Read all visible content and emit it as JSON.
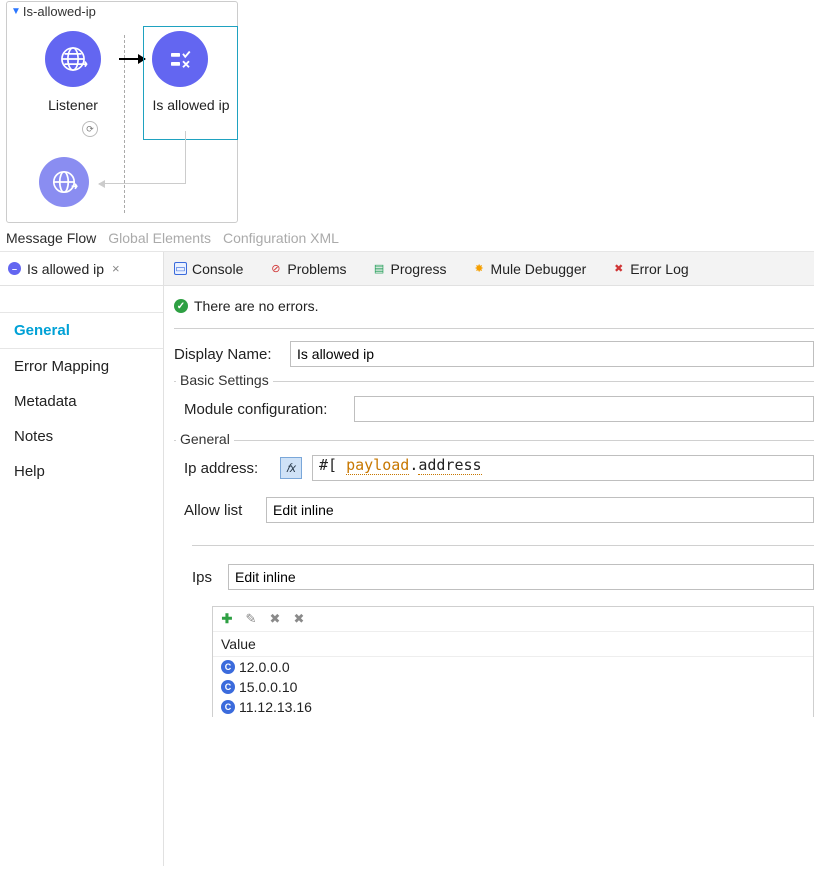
{
  "flow": {
    "title": "Is-allowed-ip",
    "listener_label": "Listener",
    "component_label": "Is allowed ip"
  },
  "editor_tabs": {
    "message_flow": "Message Flow",
    "global_elements": "Global Elements",
    "config_xml": "Configuration XML"
  },
  "detail_tab": {
    "label": "Is allowed ip"
  },
  "side_nav": {
    "general": "General",
    "error_mapping": "Error Mapping",
    "metadata": "Metadata",
    "notes": "Notes",
    "help": "Help"
  },
  "tabstrip": {
    "console": "Console",
    "problems": "Problems",
    "progress": "Progress",
    "mule_debugger": "Mule Debugger",
    "error_log": "Error Log"
  },
  "status": {
    "message": "There are no errors."
  },
  "form": {
    "display_name_label": "Display Name:",
    "display_name_value": "Is allowed ip",
    "basic_legend": "Basic Settings",
    "module_config_label": "Module configuration:",
    "module_config_value": "",
    "general_legend": "General",
    "ip_address_label": "Ip address:",
    "ip_expr_prefix": "#[ ",
    "ip_expr_payload": "payload",
    "ip_expr_dot": ".",
    "ip_expr_address": "address",
    "allow_list_label": "Allow list",
    "allow_list_value": "Edit inline",
    "ips_label": "Ips",
    "ips_value": "Edit inline"
  },
  "ips_table": {
    "header": "Value",
    "rows": [
      "12.0.0.0",
      "15.0.0.10",
      "11.12.13.16"
    ]
  }
}
